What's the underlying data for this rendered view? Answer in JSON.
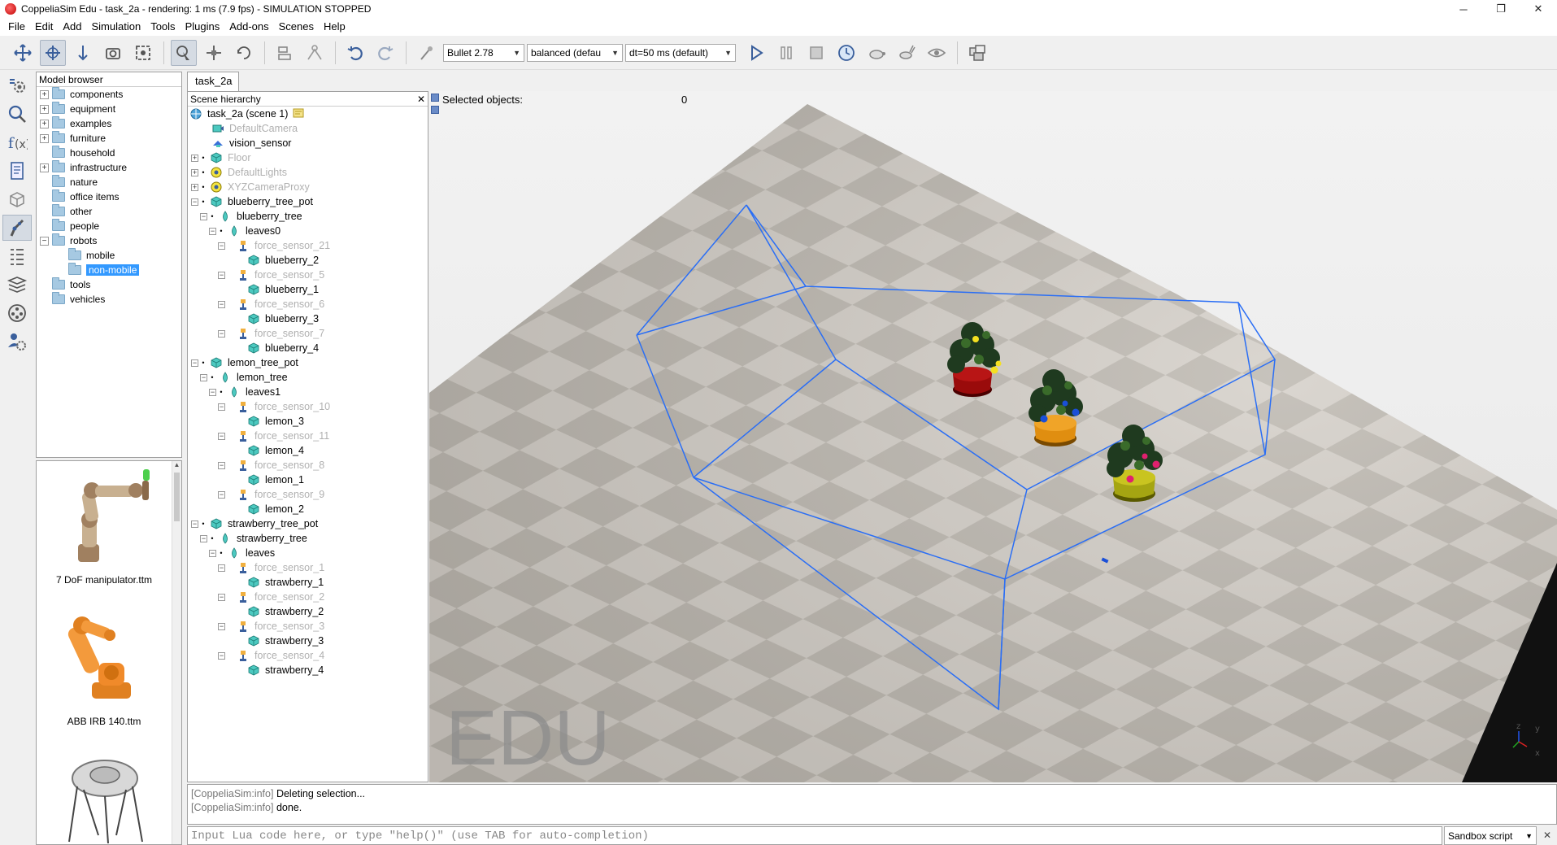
{
  "window": {
    "title": "CoppeliaSim Edu - task_2a - rendering: 1 ms (7.9 fps) - SIMULATION STOPPED",
    "minimize": "─",
    "restore": "❐",
    "close": "✕"
  },
  "menu": [
    "File",
    "Edit",
    "Add",
    "Simulation",
    "Tools",
    "Plugins",
    "Add-ons",
    "Scenes",
    "Help"
  ],
  "toolbar": {
    "engine": "Bullet 2.78",
    "accuracy": "balanced (defau",
    "timestep": "dt=50 ms (default)"
  },
  "model_browser": {
    "title": "Model browser",
    "items": [
      {
        "label": "components",
        "expandable": true
      },
      {
        "label": "equipment",
        "expandable": true
      },
      {
        "label": "examples",
        "expandable": true
      },
      {
        "label": "furniture",
        "expandable": true
      },
      {
        "label": "household",
        "expandable": false
      },
      {
        "label": "infrastructure",
        "expandable": true
      },
      {
        "label": "nature",
        "expandable": false
      },
      {
        "label": "office items",
        "expandable": false
      },
      {
        "label": "other",
        "expandable": false
      },
      {
        "label": "people",
        "expandable": false
      },
      {
        "label": "robots",
        "expandable": true,
        "expanded": true
      },
      {
        "label": "mobile",
        "child": true
      },
      {
        "label": "non-mobile",
        "child": true,
        "selected": true
      },
      {
        "label": "tools",
        "expandable": false
      },
      {
        "label": "vehicles",
        "expandable": false
      }
    ]
  },
  "thumbnails": [
    {
      "label": "7 DoF manipulator.ttm"
    },
    {
      "label": "ABB IRB 140.ttm"
    },
    {
      "label": ""
    }
  ],
  "scene_tab": "task_2a",
  "hierarchy": {
    "title": "Scene hierarchy",
    "close": "✕",
    "rows": [
      {
        "label": "task_2a (scene 1)",
        "indent": 0,
        "icon": "scene",
        "faded": false
      },
      {
        "label": "DefaultCamera",
        "indent": 1,
        "icon": "camera",
        "faded": true
      },
      {
        "label": "vision_sensor",
        "indent": 1,
        "icon": "vision",
        "faded": false
      },
      {
        "label": "Floor",
        "indent": 1,
        "icon": "shape",
        "faded": true,
        "exp": "+"
      },
      {
        "label": "DefaultLights",
        "indent": 1,
        "icon": "light",
        "faded": true,
        "exp": "+"
      },
      {
        "label": "XYZCameraProxy",
        "indent": 1,
        "icon": "light",
        "faded": true,
        "exp": "+"
      },
      {
        "label": "blueberry_tree_pot",
        "indent": 1,
        "icon": "shape",
        "faded": false,
        "exp": "-"
      },
      {
        "label": "blueberry_tree",
        "indent": 2,
        "icon": "drop",
        "faded": false,
        "exp": "-"
      },
      {
        "label": "leaves0",
        "indent": 3,
        "icon": "drop",
        "faded": false,
        "exp": "-"
      },
      {
        "label": "force_sensor_21",
        "indent": 4,
        "icon": "force",
        "faded": true,
        "exp": "-"
      },
      {
        "label": "blueberry_2",
        "indent": 5,
        "icon": "shape",
        "faded": false
      },
      {
        "label": "force_sensor_5",
        "indent": 4,
        "icon": "force",
        "faded": true,
        "exp": "-"
      },
      {
        "label": "blueberry_1",
        "indent": 5,
        "icon": "shape",
        "faded": false
      },
      {
        "label": "force_sensor_6",
        "indent": 4,
        "icon": "force",
        "faded": true,
        "exp": "-"
      },
      {
        "label": "blueberry_3",
        "indent": 5,
        "icon": "shape",
        "faded": false
      },
      {
        "label": "force_sensor_7",
        "indent": 4,
        "icon": "force",
        "faded": true,
        "exp": "-"
      },
      {
        "label": "blueberry_4",
        "indent": 5,
        "icon": "shape",
        "faded": false
      },
      {
        "label": "lemon_tree_pot",
        "indent": 1,
        "icon": "shape",
        "faded": false,
        "exp": "-"
      },
      {
        "label": "lemon_tree",
        "indent": 2,
        "icon": "drop",
        "faded": false,
        "exp": "-"
      },
      {
        "label": "leaves1",
        "indent": 3,
        "icon": "drop",
        "faded": false,
        "exp": "-"
      },
      {
        "label": "force_sensor_10",
        "indent": 4,
        "icon": "force",
        "faded": true,
        "exp": "-"
      },
      {
        "label": "lemon_3",
        "indent": 5,
        "icon": "shape",
        "faded": false
      },
      {
        "label": "force_sensor_11",
        "indent": 4,
        "icon": "force",
        "faded": true,
        "exp": "-"
      },
      {
        "label": "lemon_4",
        "indent": 5,
        "icon": "shape",
        "faded": false
      },
      {
        "label": "force_sensor_8",
        "indent": 4,
        "icon": "force",
        "faded": true,
        "exp": "-"
      },
      {
        "label": "lemon_1",
        "indent": 5,
        "icon": "shape",
        "faded": false
      },
      {
        "label": "force_sensor_9",
        "indent": 4,
        "icon": "force",
        "faded": true,
        "exp": "-"
      },
      {
        "label": "lemon_2",
        "indent": 5,
        "icon": "shape",
        "faded": false
      },
      {
        "label": "strawberry_tree_pot",
        "indent": 1,
        "icon": "shape",
        "faded": false,
        "exp": "-"
      },
      {
        "label": "strawberry_tree",
        "indent": 2,
        "icon": "drop",
        "faded": false,
        "exp": "-"
      },
      {
        "label": "leaves",
        "indent": 3,
        "icon": "drop",
        "faded": false,
        "exp": "-"
      },
      {
        "label": "force_sensor_1",
        "indent": 4,
        "icon": "force",
        "faded": true,
        "exp": "-"
      },
      {
        "label": "strawberry_1",
        "indent": 5,
        "icon": "shape",
        "faded": false
      },
      {
        "label": "force_sensor_2",
        "indent": 4,
        "icon": "force",
        "faded": true,
        "exp": "-"
      },
      {
        "label": "strawberry_2",
        "indent": 5,
        "icon": "shape",
        "faded": false
      },
      {
        "label": "force_sensor_3",
        "indent": 4,
        "icon": "force",
        "faded": true,
        "exp": "-"
      },
      {
        "label": "strawberry_3",
        "indent": 5,
        "icon": "shape",
        "faded": false
      },
      {
        "label": "force_sensor_4",
        "indent": 4,
        "icon": "force",
        "faded": true,
        "exp": "-"
      },
      {
        "label": "strawberry_4",
        "indent": 5,
        "icon": "shape",
        "faded": false
      }
    ]
  },
  "viewport": {
    "selected_label": "Selected objects:",
    "selected_count": "0",
    "watermark": "EDU",
    "axis_z": "z",
    "axis_y": "y",
    "axis_x": "x",
    "bounding_box_color": "#2a6ef5"
  },
  "console": {
    "lines": [
      {
        "tag": "[CoppeliaSim:info]",
        "text": "Deleting selection..."
      },
      {
        "tag": "[CoppeliaSim:info]",
        "text": "done."
      }
    ]
  },
  "lua": {
    "placeholder": "Input Lua code here, or type \"help()\" (use TAB for auto-completion)",
    "script_mode": "Sandbox script",
    "close": "✕"
  },
  "colors": {
    "selection": "#3399ff",
    "folder": "#a6c9e2",
    "shape_icon": "#4cc9c0",
    "faded_text": "#b0b0b0"
  }
}
